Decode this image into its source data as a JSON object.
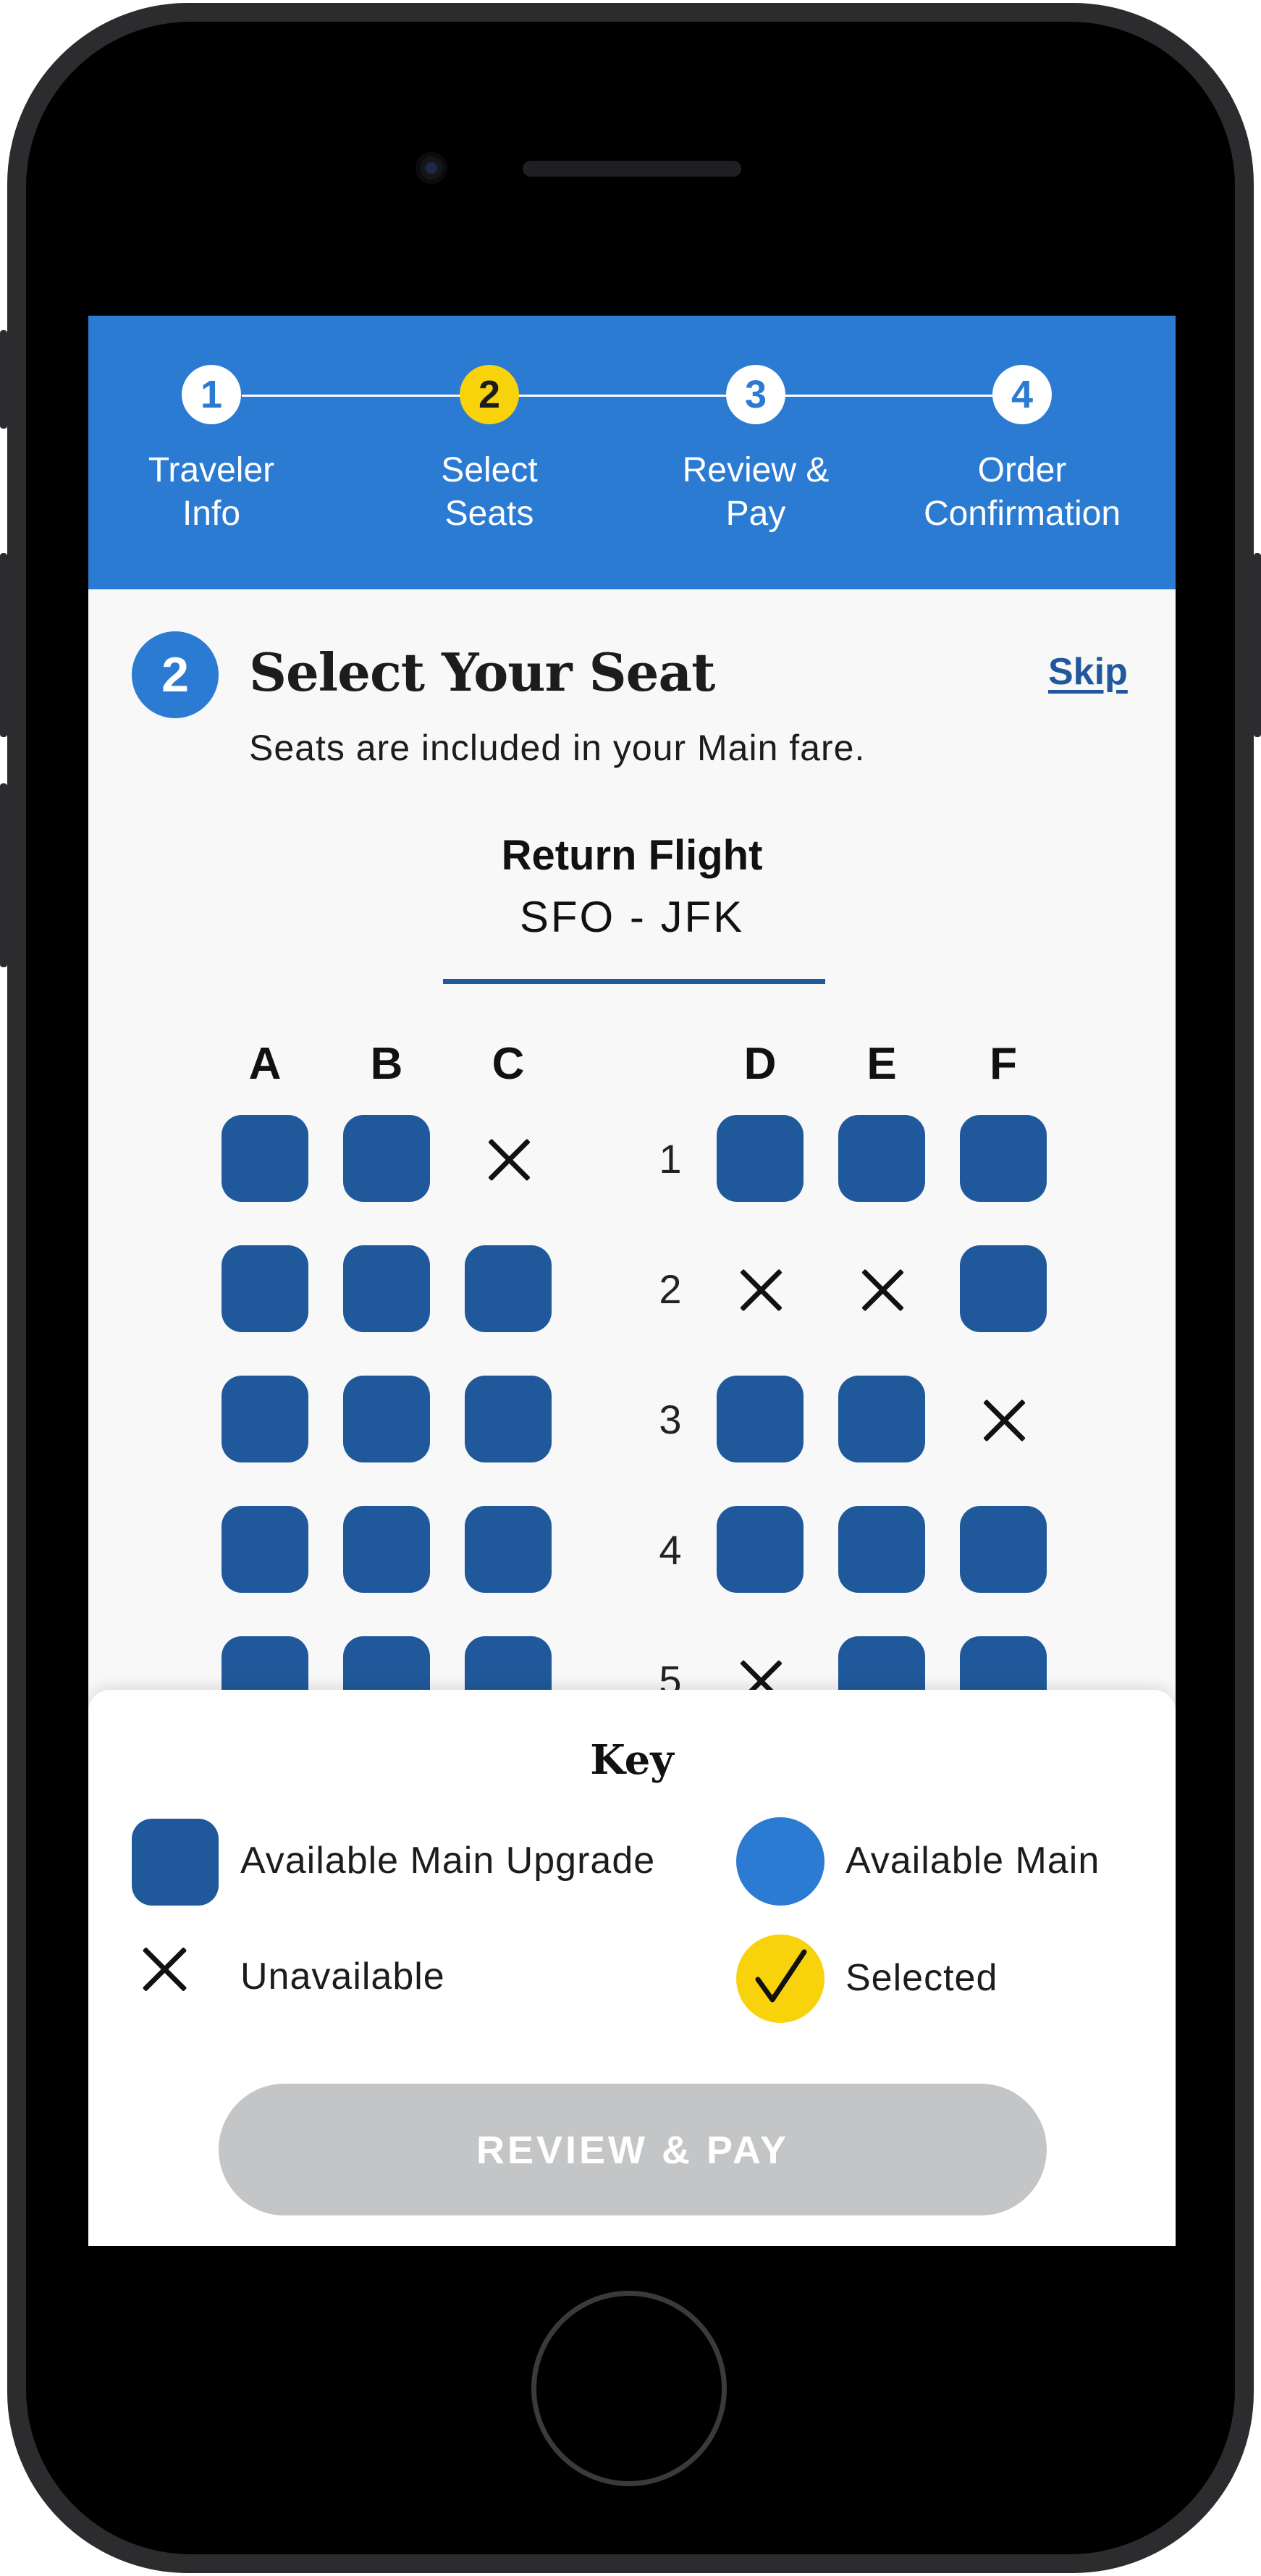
{
  "stepper": {
    "steps": [
      {
        "number": "1",
        "label": "Traveler\nInfo",
        "state": "complete"
      },
      {
        "number": "2",
        "label": "Select\nSeats",
        "state": "active"
      },
      {
        "number": "3",
        "label": "Review &\nPay",
        "state": "upcoming"
      },
      {
        "number": "4",
        "label": "Order\nConfirmation",
        "state": "upcoming"
      }
    ]
  },
  "section": {
    "badge": "2",
    "title": "Select Your Seat",
    "subtitle": "Seats are included in your Main fare.",
    "skip_label": "Skip"
  },
  "flight": {
    "title": "Return Flight",
    "route": "SFO - JFK"
  },
  "seat_map": {
    "columns": [
      "A",
      "B",
      "C",
      "D",
      "E",
      "F"
    ],
    "rows": [
      {
        "number": "1",
        "seats": [
          "upgrade",
          "upgrade",
          "unavailable",
          "upgrade",
          "upgrade",
          "upgrade"
        ]
      },
      {
        "number": "2",
        "seats": [
          "upgrade",
          "upgrade",
          "upgrade",
          "unavailable",
          "unavailable",
          "upgrade"
        ]
      },
      {
        "number": "3",
        "seats": [
          "upgrade",
          "upgrade",
          "upgrade",
          "upgrade",
          "upgrade",
          "unavailable"
        ]
      },
      {
        "number": "4",
        "seats": [
          "upgrade",
          "upgrade",
          "upgrade",
          "upgrade",
          "upgrade",
          "upgrade"
        ]
      },
      {
        "number": "5",
        "seats": [
          "upgrade",
          "upgrade",
          "upgrade",
          "unavailable",
          "upgrade",
          "upgrade"
        ]
      }
    ]
  },
  "key": {
    "title": "Key",
    "available_upgrade": "Available Main Upgrade",
    "available_main": "Available Main",
    "unavailable": "Unavailable",
    "selected": "Selected"
  },
  "review_button": {
    "label": "REVIEW & PAY",
    "enabled": false
  },
  "colors": {
    "primary_blue": "#2b7bd2",
    "seat_blue": "#20599b",
    "active_yellow": "#f8d30c",
    "disabled_gray": "#c4c5c6"
  }
}
